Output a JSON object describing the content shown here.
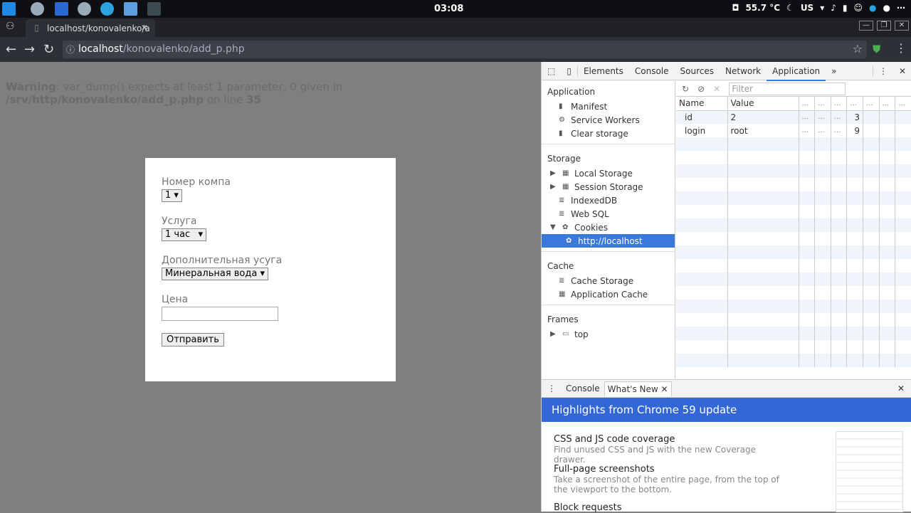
{
  "taskbar": {
    "clock": "03:08",
    "temperature": "55.7 °C",
    "keyboard": "US"
  },
  "browser": {
    "tab_title": "localhost/konovalenko/a",
    "url_host": "localhost",
    "url_path": "/konovalenko/add_p.php"
  },
  "page": {
    "warning_label": "Warning",
    "warning_text": ": var_dump() expects at least 1 parameter, 0 given in",
    "warning_path": "/srv/http/konovalenko/add_p.php",
    "warning_online": " on line ",
    "warning_line": "35",
    "form": {
      "comp_label": "Номер компа",
      "comp_value": "1",
      "service_label": "Услуга",
      "service_value": "1 час",
      "extra_label": "Дополнительная усуга",
      "extra_value": "Минеральная вода",
      "price_label": "Цена",
      "price_value": "",
      "submit": "Отправить"
    }
  },
  "devtools": {
    "tabs": [
      "Elements",
      "Console",
      "Sources",
      "Network",
      "Application"
    ],
    "more": "»",
    "sidebar": {
      "application_header": "Application",
      "application_items": [
        "Manifest",
        "Service Workers",
        "Clear storage"
      ],
      "storage_header": "Storage",
      "storage_items": [
        "Local Storage",
        "Session Storage",
        "IndexedDB",
        "Web SQL",
        "Cookies"
      ],
      "cookie_origin": "http://localhost",
      "cache_header": "Cache",
      "cache_items": [
        "Cache Storage",
        "Application Cache"
      ],
      "frames_header": "Frames",
      "frames_item": "top"
    },
    "filter_placeholder": "Filter",
    "columns": [
      "Name",
      "Value",
      "...",
      "...",
      "...",
      "...",
      "...",
      "...",
      "..."
    ],
    "cookies": [
      {
        "name": "id",
        "value": "2",
        "size": "3"
      },
      {
        "name": "login",
        "value": "root",
        "size": "9"
      }
    ],
    "drawer": {
      "tabs": [
        "Console",
        "What's New"
      ],
      "banner": "Highlights from Chrome 59 update",
      "features": [
        {
          "title": "CSS and JS code coverage",
          "desc": "Find unused CSS and JS with the new Coverage drawer."
        },
        {
          "title": "Full-page screenshots",
          "desc": "Take a screenshot of the entire page, from the top of the viewport to the bottom."
        },
        {
          "title": "Block requests",
          "desc": ""
        }
      ]
    }
  }
}
